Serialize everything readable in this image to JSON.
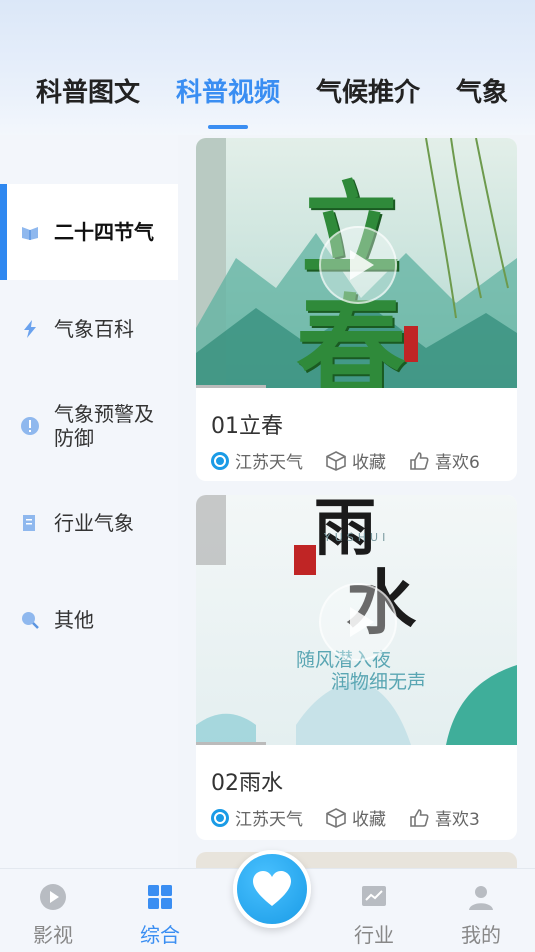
{
  "tabs": [
    {
      "label": "科普图文",
      "active": false
    },
    {
      "label": "科普视频",
      "active": true
    },
    {
      "label": "气候推介",
      "active": false
    },
    {
      "label": "气象",
      "active": false
    }
  ],
  "sidebar": {
    "items": [
      {
        "label": "二十四节气",
        "icon": "book-icon",
        "active": true
      },
      {
        "label": "气象百科",
        "icon": "lightning-icon",
        "active": false
      },
      {
        "label": "气象预警及防御",
        "icon": "warning-icon",
        "active": false
      },
      {
        "label": "行业气象",
        "icon": "document-icon",
        "active": false
      },
      {
        "label": "其他",
        "icon": "search-icon",
        "active": false
      }
    ]
  },
  "videos": [
    {
      "title": "01立春",
      "source": "江苏天气",
      "collect_label": "收藏",
      "like_label": "喜欢6",
      "thumb_big_char_top": "立",
      "thumb_big_char_bottom": "春"
    },
    {
      "title": "02雨水",
      "source": "江苏天气",
      "collect_label": "收藏",
      "like_label": "喜欢3",
      "thumb_big_char_top": "雨",
      "thumb_big_char_bottom": "水",
      "thumb_caption_en": "YUSHUI",
      "thumb_poem_1": "随风潜入夜",
      "thumb_poem_2": "润物细无声"
    }
  ],
  "bottom_nav": [
    {
      "label": "影视",
      "icon": "play-circle-icon",
      "active": false
    },
    {
      "label": "综合",
      "icon": "grid-icon",
      "active": true
    },
    {
      "label": "行业",
      "icon": "chart-icon",
      "active": false
    },
    {
      "label": "我的",
      "icon": "user-icon",
      "active": false
    }
  ],
  "center_button": {
    "icon": "heart-icon"
  },
  "colors": {
    "accent": "#3a8ef2",
    "source_icon": "#1a9be6"
  }
}
